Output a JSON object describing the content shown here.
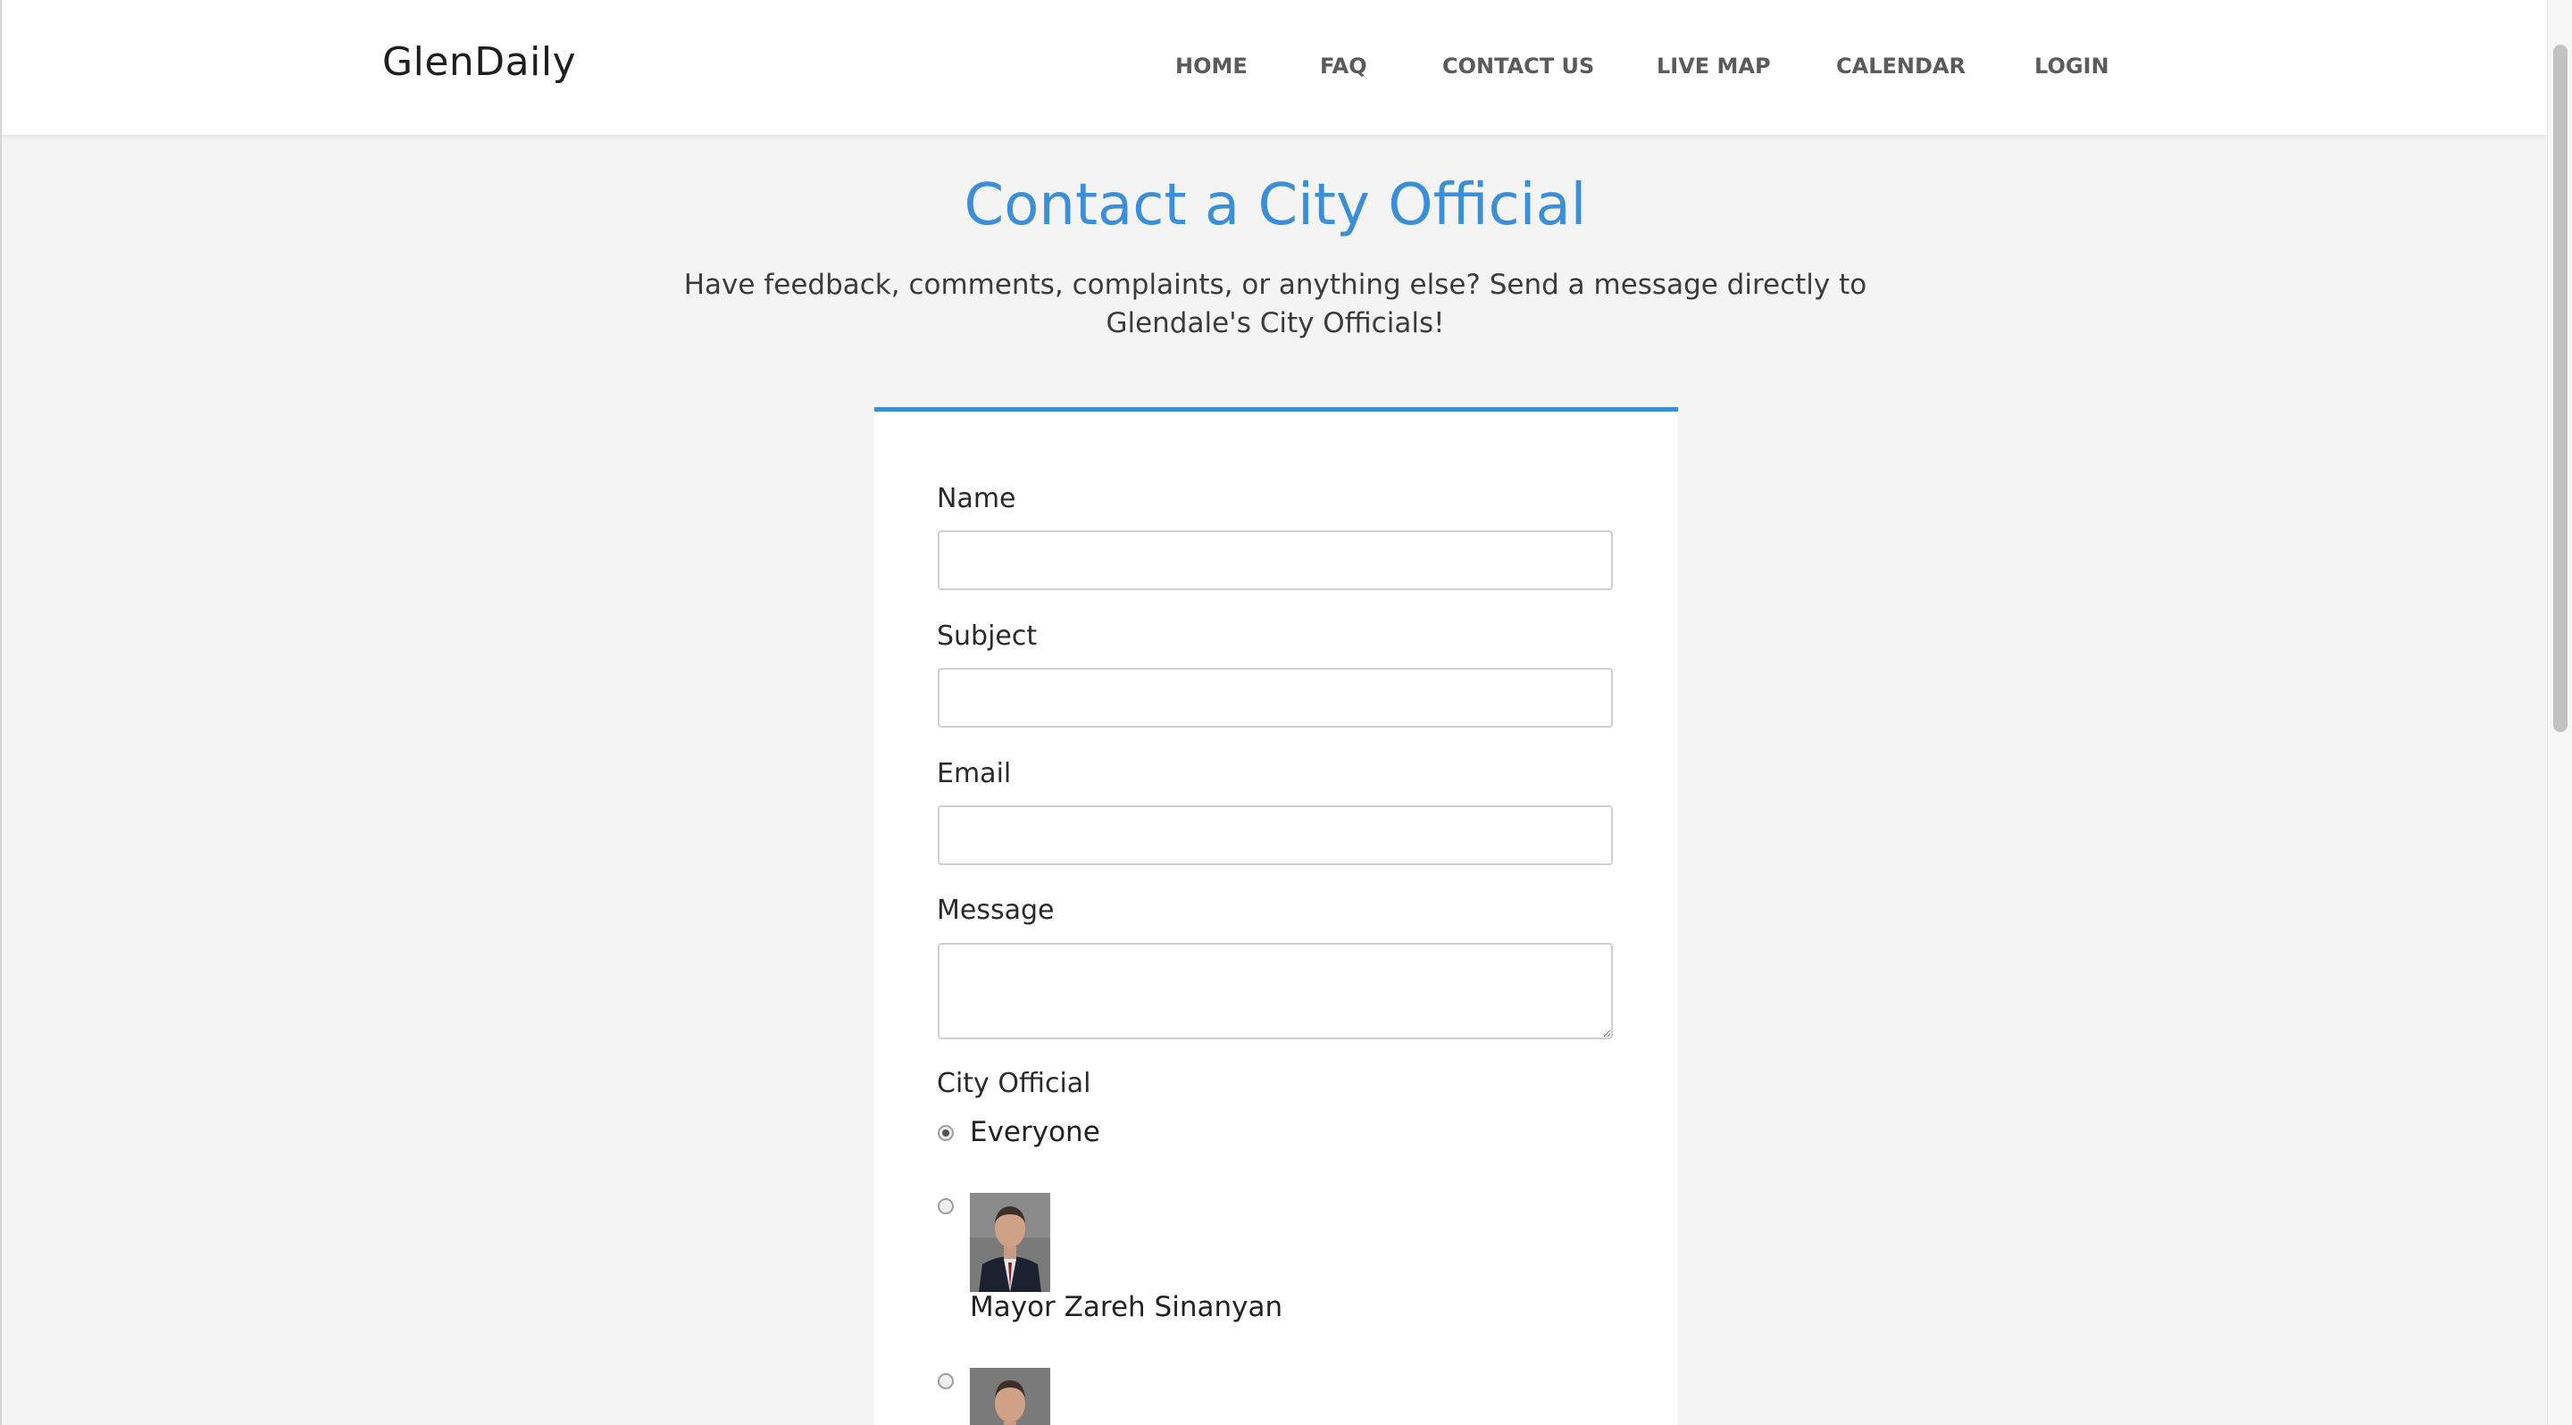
{
  "brand": "GlenDaily",
  "nav": [
    {
      "label": "HOME"
    },
    {
      "label": "FAQ"
    },
    {
      "label": "CONTACT US"
    },
    {
      "label": "LIVE MAP"
    },
    {
      "label": "CALENDAR"
    },
    {
      "label": "LOGIN"
    }
  ],
  "header": {
    "title": "Contact a City Official",
    "subtitle": "Have feedback, comments, complaints, or anything else? Send a message directly to Glendale's City Officials!"
  },
  "form": {
    "name_label": "Name",
    "name_value": "",
    "subject_label": "Subject",
    "subject_value": "",
    "email_label": "Email",
    "email_value": "",
    "message_label": "Message",
    "message_value": "",
    "official_label": "City Official",
    "options": [
      {
        "label": "Everyone",
        "checked": true
      },
      {
        "label": "Mayor Zareh Sinanyan",
        "checked": false
      },
      {
        "label": "",
        "checked": false
      }
    ]
  },
  "colors": {
    "accent": "#3a8fd8",
    "background": "#f4f4f4",
    "card": "#ffffff"
  }
}
